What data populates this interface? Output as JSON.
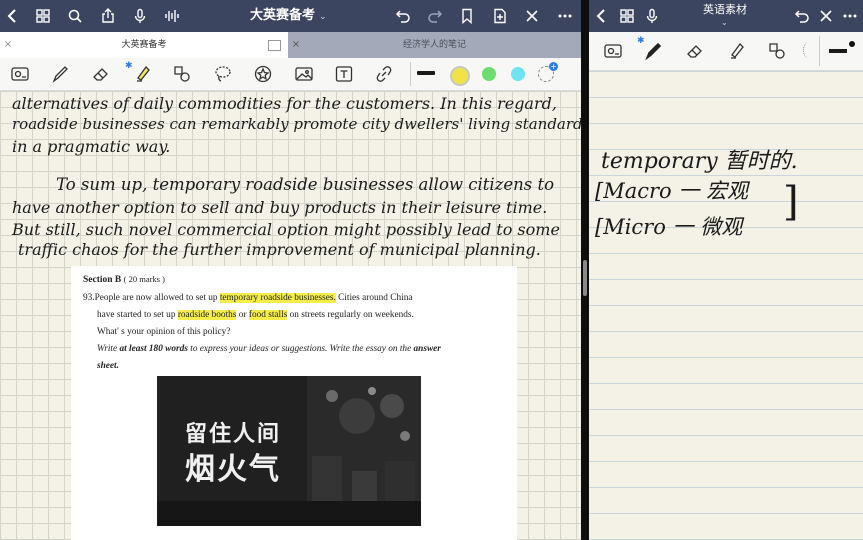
{
  "left_pane": {
    "nav": {
      "title": "大英赛备考",
      "title_caret": "⌄",
      "icons": [
        "chevron-left-icon",
        "grid-icon",
        "search-icon",
        "share-icon",
        "mic-icon",
        "waveform-icon",
        "undo-icon",
        "redo-icon",
        "bookmark-icon",
        "add-page-icon",
        "close-icon",
        "more-icon"
      ]
    },
    "tabs": [
      {
        "label": "大英赛备考",
        "active": true
      },
      {
        "label": "经济学人的笔记",
        "active": false
      }
    ],
    "toolbar": {
      "tools": [
        "lasso-image-icon",
        "pen-icon",
        "eraser-icon",
        "highlighter-icon",
        "shapes-icon",
        "lasso-icon",
        "sticker-icon",
        "image-icon",
        "textbox-icon",
        "link-icon"
      ],
      "colors": [
        "#1a1a1a",
        "#f0e34a",
        "#6fdc6f",
        "#6fe3f0"
      ]
    },
    "handwriting": [
      "alternatives of daily commodities for the customers. In this regard,",
      "roadside businesses can remarkably promote city dwellers' living standards",
      "in a pragmatic way.",
      "To sum up, temporary roadside businesses allow citizens to",
      "have another option to sell and buy products in their leisure time.",
      "But still, such novel commercial option might possibly lead to some",
      "traffic chaos for the further improvement of municipal planning."
    ],
    "document": {
      "section_label": "Section B",
      "section_marks": "( 20 marks )",
      "q_number": "93.",
      "l1_a": "People are now allowed to set up ",
      "l1_hl": "temporary roadside businesses.",
      "l1_b": " Cities around China",
      "l2_a": "have started to set up ",
      "l2_hl1": "roadside booths",
      "l2_b": " or ",
      "l2_hl2": "food stalls",
      "l2_c": " on streets regularly on weekends.",
      "l3": "What' s your opinion of this policy?",
      "l4_a": "Write ",
      "l4_b": "at least 180 words",
      "l4_c": " to express your ideas or suggestions. Write the essay on the ",
      "l4_d": "answer",
      "l5": "sheet.",
      "image_caption_line1": "留住人间",
      "image_caption_line2": "烟火气"
    }
  },
  "right_pane": {
    "nav": {
      "title": "英语素材",
      "title_caret": "⌄",
      "icons": [
        "chevron-left-icon",
        "grid-icon",
        "mic-icon",
        "undo-icon",
        "close-icon",
        "more-icon"
      ]
    },
    "toolbar": {
      "tools": [
        "lasso-image-icon",
        "pen-icon",
        "eraser-icon",
        "highlighter-icon",
        "shapes-icon"
      ]
    },
    "handwriting": [
      "temporary 暂时的.",
      "Macro 一 宏观",
      "Micro 一 微观"
    ]
  }
}
